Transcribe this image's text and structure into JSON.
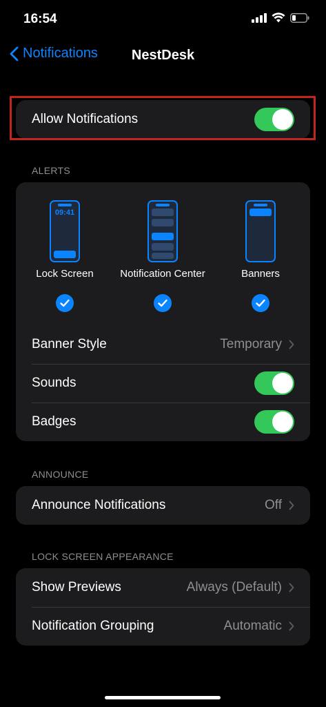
{
  "status_bar": {
    "time": "16:54"
  },
  "nav": {
    "back_label": "Notifications",
    "title": "NestDesk"
  },
  "allow_notifications": {
    "label": "Allow Notifications",
    "enabled": true
  },
  "alerts": {
    "header": "ALERTS",
    "lock_screen_time": "09:41",
    "options": [
      {
        "label": "Lock Screen",
        "checked": true
      },
      {
        "label": "Notification Center",
        "checked": true
      },
      {
        "label": "Banners",
        "checked": true
      }
    ],
    "banner_style": {
      "label": "Banner Style",
      "value": "Temporary"
    },
    "sounds": {
      "label": "Sounds",
      "enabled": true
    },
    "badges": {
      "label": "Badges",
      "enabled": true
    }
  },
  "announce": {
    "header": "ANNOUNCE",
    "announce_notifications": {
      "label": "Announce Notifications",
      "value": "Off"
    }
  },
  "lock_screen_appearance": {
    "header": "LOCK SCREEN APPEARANCE",
    "show_previews": {
      "label": "Show Previews",
      "value": "Always (Default)"
    },
    "notification_grouping": {
      "label": "Notification Grouping",
      "value": "Automatic"
    }
  },
  "colors": {
    "accent": "#0a84ff",
    "toggle_on": "#34c759",
    "highlight": "#c0261c",
    "cell": "#1c1c1e"
  }
}
